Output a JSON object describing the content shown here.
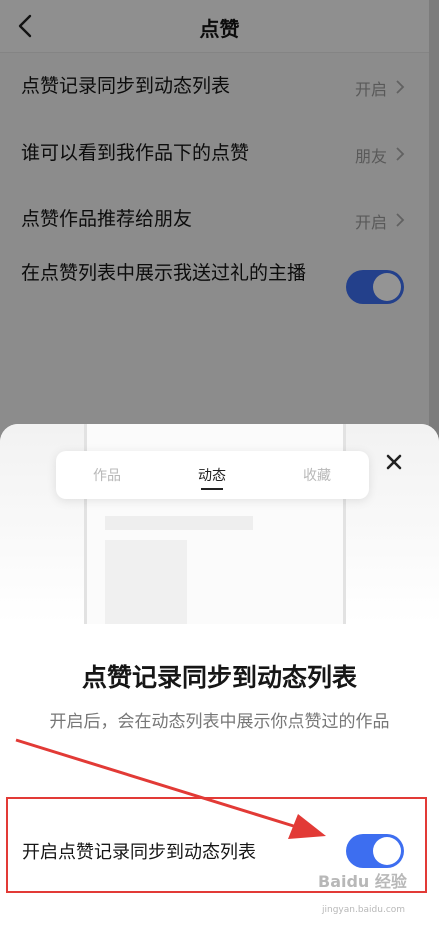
{
  "header": {
    "title": "点赞"
  },
  "settings": [
    {
      "label": "点赞记录同步到动态列表",
      "value": "开启"
    },
    {
      "label": "谁可以看到我作品下的点赞",
      "value": "朋友"
    },
    {
      "label": "点赞作品推荐给朋友",
      "value": "开启"
    }
  ],
  "gift_toggle": {
    "label": "在点赞列表中展示我送过礼的主播",
    "on": true
  },
  "sheet": {
    "tabs": [
      "作品",
      "动态",
      "收藏"
    ],
    "active_tab": "动态",
    "title": "点赞记录同步到动态列表",
    "description": "开启后，会在动态列表中展示你点赞过的作品",
    "setting": {
      "label": "开启点赞记录同步到动态列表",
      "on": true
    }
  },
  "watermark": {
    "main": "Baidu 经验",
    "sub": "jingyan.baidu.com"
  },
  "colors": {
    "accent": "#3d6ef0",
    "highlight": "#e23a36"
  }
}
